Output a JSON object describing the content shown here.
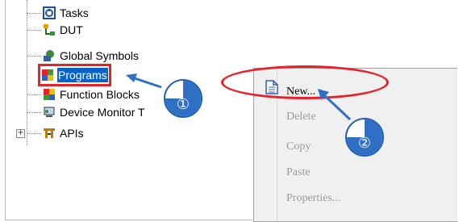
{
  "tree": {
    "items": [
      {
        "label": "Tasks",
        "icon": "tasks-icon"
      },
      {
        "label": "DUT",
        "icon": "dut-icon"
      },
      {
        "label": "Global Symbols",
        "icon": "global-symbols-icon"
      },
      {
        "label": "Programs",
        "icon": "programs-icon",
        "selected": true
      },
      {
        "label": "Function Blocks",
        "icon": "function-blocks-icon"
      },
      {
        "label": "Device Monitor T",
        "icon": "device-monitor-icon"
      },
      {
        "label": "APIs",
        "icon": "apis-icon",
        "expandable": true
      }
    ],
    "expander_glyph": "+"
  },
  "context_menu": {
    "items": [
      {
        "label": "New...",
        "enabled": true,
        "icon": "new-document-icon"
      },
      {
        "label": "Delete",
        "enabled": false
      },
      {
        "label": "Copy",
        "enabled": false
      },
      {
        "label": "Paste",
        "enabled": false
      },
      {
        "label": "Properties...",
        "enabled": false
      }
    ]
  },
  "callouts": [
    {
      "number": "①"
    },
    {
      "number": "②"
    }
  ],
  "colors": {
    "highlight_red": "#e8202a",
    "selection_blue": "#0a64c8",
    "callout_blue": "#2f6fc4"
  }
}
